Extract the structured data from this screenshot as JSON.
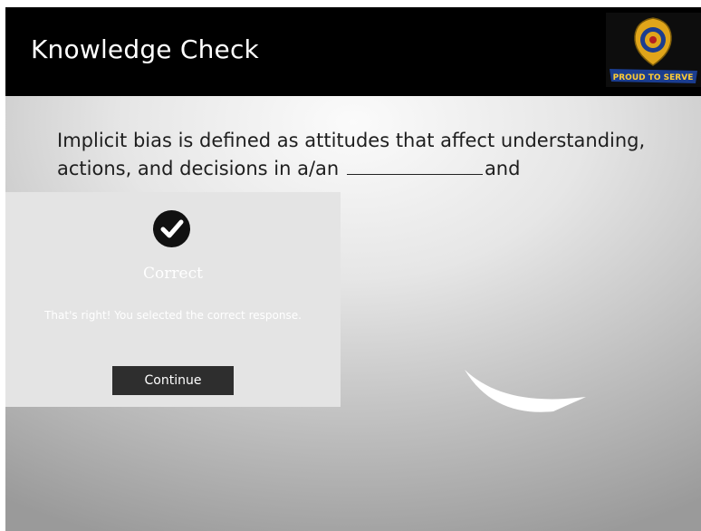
{
  "header": {
    "title": "Knowledge Check",
    "logo": {
      "icon": "police-badge-icon",
      "text": "PROUD TO SERVE"
    }
  },
  "question": {
    "text_before": "Implicit bias is defined as attitudes that affect understanding, actions, and decisions in a/an",
    "text_after": "and"
  },
  "feedback": {
    "icon": "checkmark-circle-icon",
    "title": "Correct",
    "message": "That's right! You selected the correct response.",
    "continue_label": "Continue"
  },
  "colors": {
    "header_bg": "#000000",
    "panel_bg": "#e4e4e4",
    "button_bg": "#2e2e2e",
    "logo_gold": "#e0a51a",
    "logo_blue": "#1b3d8f"
  }
}
